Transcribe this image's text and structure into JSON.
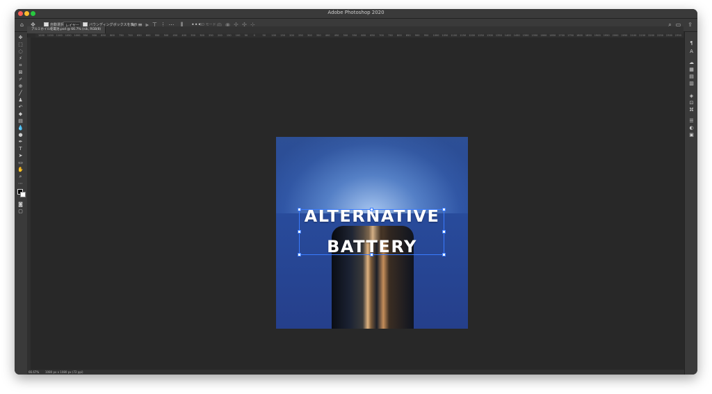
{
  "window": {
    "title": "Adobe Photoshop 2020"
  },
  "options_bar": {
    "auto_select_label": "自動選択 :",
    "layer_dropdown": "レイヤー",
    "show_transform_label": "バウンディングボックスを表示",
    "mode_3d": "3D モード :"
  },
  "document_tab": {
    "label": "アルミホイル乾電池.psd @ 66.7% (nik, RGB/8)"
  },
  "ruler": {
    "ticks": [
      "1200",
      "1150",
      "1100",
      "1050",
      "1000",
      "950",
      "900",
      "850",
      "800",
      "750",
      "700",
      "650",
      "600",
      "550",
      "500",
      "450",
      "400",
      "350",
      "300",
      "250",
      "200",
      "150",
      "100",
      "50",
      "0",
      "50",
      "100",
      "150",
      "200",
      "250",
      "300",
      "350",
      "400",
      "450",
      "500",
      "550",
      "600",
      "650",
      "700",
      "750",
      "800",
      "850",
      "900",
      "950",
      "1000",
      "1050",
      "1100",
      "1150",
      "1200",
      "1250",
      "1300",
      "1350",
      "1400",
      "1450",
      "1500",
      "1550",
      "1600",
      "1650",
      "1700",
      "1750",
      "1800",
      "1850",
      "1900",
      "1950",
      "2000",
      "2050",
      "2100",
      "2150",
      "2200",
      "2250",
      "2300",
      "2350"
    ]
  },
  "canvas": {
    "line1": "ALTERNATIVE",
    "line2": "BATTERY"
  },
  "status": {
    "zoom": "66.67%",
    "doc_info": "1080 px x 1080 px (72 ppi)"
  },
  "colors": {
    "accent": "#3a7bff",
    "image_bg": "#284b9b"
  }
}
